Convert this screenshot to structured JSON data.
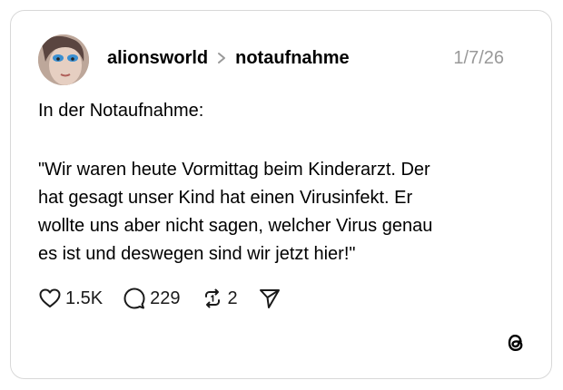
{
  "post": {
    "username": "alionsworld",
    "community": "notaufnahme",
    "date": "1/7/26",
    "intro": "In der Notaufnahme:",
    "quote_lines": [
      "\"Wir waren heute Vormittag beim Kinderarzt. Der",
      "hat gesagt unser Kind hat einen Virusinfekt. Er",
      "wollte uns aber nicht sagen, welcher Virus genau",
      "es ist und deswegen sind wir jetzt hier!\""
    ]
  },
  "actions": {
    "likes": "1.5K",
    "replies": "229",
    "reposts": "2"
  },
  "icons": {
    "like": "heart-icon",
    "reply": "comment-icon",
    "repost": "repost-icon",
    "share": "send-icon",
    "brand": "threads-logo-icon",
    "separator": "chevron-right-icon"
  }
}
